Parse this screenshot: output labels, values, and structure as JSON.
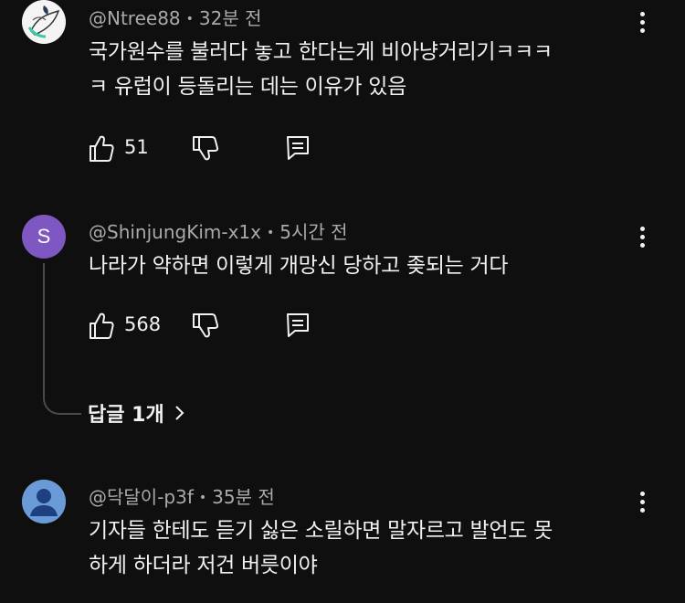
{
  "comments": [
    {
      "handle": "@Ntree88",
      "time": "32분 전",
      "text_lines": [
        "국가원수를 불러다 놓고 한다는게 비아냥거리기ㅋㅋㅋ",
        "ㅋ 유럽이 등돌리는 데는 이유가 있음"
      ],
      "likes": "51"
    },
    {
      "avatar_letter": "S",
      "avatar_color": "#7e57c2",
      "handle": "@ShinjungKim-x1x",
      "time": "5시간 전",
      "text_lines": [
        "나라가 약하면 이렇게 개망신 당하고 좆되는 거다"
      ],
      "likes": "568",
      "replies_label": "답글 1개"
    },
    {
      "avatar_color": "#6b9bd6",
      "handle": "@닥달이-p3f",
      "time": "35분 전",
      "text_lines": [
        "기자들 한테도 듣기 싫은 소릴하면 말자르고 발언도 못",
        "하게 하더라 저건 버릇이야"
      ]
    }
  ],
  "colors": {
    "background": "#0f0f0f",
    "meta_text": "#aaaaaa",
    "text": "#f1f1f1"
  }
}
